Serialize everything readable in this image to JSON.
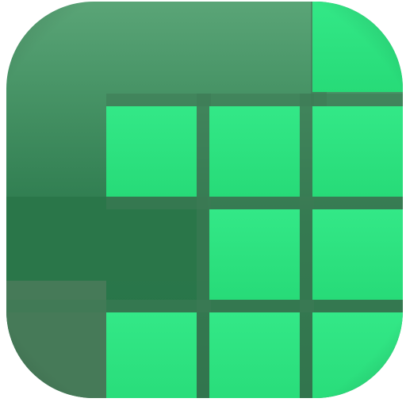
{
  "icon": {
    "name": "green-grid-app-icon",
    "colors": {
      "background_top": "#4f9c6d",
      "background_mid": "#2f7f50",
      "background_bottom": "#46765a",
      "tile": "#2ee07f",
      "tile_highlight": "#3af08b",
      "divider": "#3e7a55",
      "edge_shadow": "#1f5e3a"
    },
    "grid": {
      "rows": 4,
      "cols": 4,
      "filled_cells": [
        [
          0,
          3
        ],
        [
          1,
          1
        ],
        [
          1,
          2
        ],
        [
          1,
          3
        ],
        [
          2,
          2
        ],
        [
          2,
          3
        ],
        [
          3,
          1
        ],
        [
          3,
          2
        ],
        [
          3,
          3
        ]
      ]
    }
  }
}
